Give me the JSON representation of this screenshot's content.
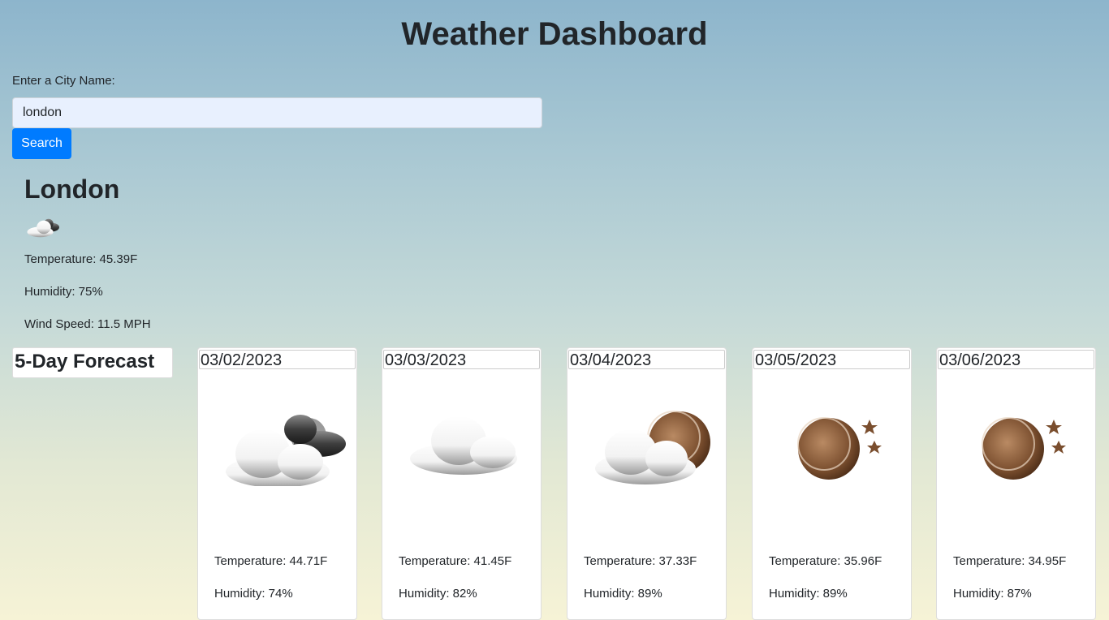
{
  "header": {
    "title": "Weather Dashboard"
  },
  "search": {
    "label": "Enter a City Name:",
    "value": "london",
    "button_label": "Search"
  },
  "current": {
    "city": "London",
    "icon": "broken-clouds-icon",
    "temperature": "Temperature: 45.39F",
    "humidity": "Humidity: 75%",
    "wind": "Wind Speed: 11.5 MPH"
  },
  "forecast": {
    "heading": "5-Day Forecast",
    "days": [
      {
        "date": "03/02/2023",
        "icon": "broken-clouds-icon",
        "temperature": "Temperature: 44.71F",
        "humidity": "Humidity: 74%"
      },
      {
        "date": "03/03/2023",
        "icon": "cloud-icon",
        "temperature": "Temperature: 41.45F",
        "humidity": "Humidity: 82%"
      },
      {
        "date": "03/04/2023",
        "icon": "cloudy-night-icon",
        "temperature": "Temperature: 37.33F",
        "humidity": "Humidity: 89%"
      },
      {
        "date": "03/05/2023",
        "icon": "clear-night-icon",
        "temperature": "Temperature: 35.96F",
        "humidity": "Humidity: 89%"
      },
      {
        "date": "03/06/2023",
        "icon": "clear-night-icon",
        "temperature": "Temperature: 34.95F",
        "humidity": "Humidity: 87%"
      }
    ]
  },
  "colors": {
    "button": "#007bff",
    "input_background": "#e8f0fe",
    "text": "#212529"
  }
}
